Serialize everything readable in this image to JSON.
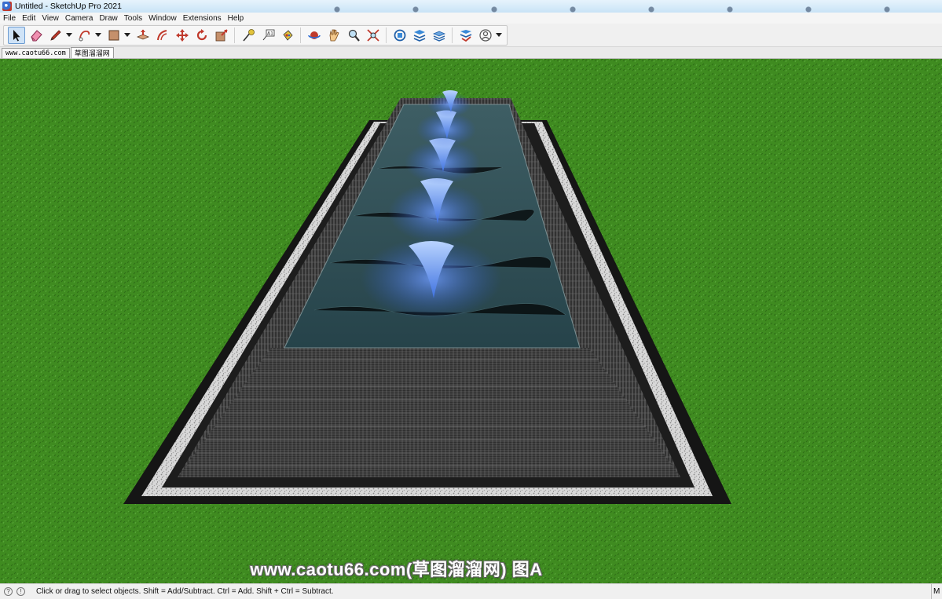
{
  "window": {
    "title": "Untitled - SketchUp Pro 2021"
  },
  "menu": [
    "File",
    "Edit",
    "View",
    "Camera",
    "Draw",
    "Tools",
    "Window",
    "Extensions",
    "Help"
  ],
  "toolbar": {
    "tools": [
      {
        "name": "select-icon",
        "selected": true
      },
      {
        "name": "eraser-icon"
      },
      {
        "name": "pencil-line-icon",
        "dropdown": true
      },
      {
        "name": "freehand-arc-icon",
        "dropdown": true
      },
      {
        "name": "rectangle-shape-icon",
        "dropdown": true
      },
      {
        "name": "push-pull-icon"
      },
      {
        "name": "offset-icon"
      },
      {
        "name": "move-icon"
      },
      {
        "name": "rotate-icon"
      },
      {
        "name": "scale-icon"
      },
      {
        "name": "tape-measure-icon"
      },
      {
        "name": "text-label-icon"
      },
      {
        "name": "paint-bucket-icon"
      },
      {
        "name": "orbit-icon"
      },
      {
        "name": "pan-icon"
      },
      {
        "name": "zoom-icon"
      },
      {
        "name": "zoom-extents-icon"
      },
      {
        "name": "warehouse-icon"
      },
      {
        "name": "extension-warehouse-icon"
      },
      {
        "name": "layout-icon"
      },
      {
        "name": "extension-manager-icon"
      },
      {
        "name": "account-icon",
        "dropdown": true
      }
    ],
    "text_tool_glyph": "A1"
  },
  "scene_tabs": [
    "www.caotu66.com",
    "草图溜溜网"
  ],
  "watermark": "www.caotu66.com(草图溜溜网) 图A",
  "status": {
    "message": "Click or drag to select objects. Shift = Add/Subtract. Ctrl = Add. Shift + Ctrl = Subtract.",
    "measurements_label": "M",
    "info_glyph": "!",
    "help_glyph": "?"
  },
  "colors": {
    "grass": "#3e8a1f",
    "sky": "#d6ecfb",
    "water": "#2e4d52",
    "fountain": "#4a7fe6",
    "stone_border": "#d9d9d9",
    "dark_edge": "#141414"
  }
}
